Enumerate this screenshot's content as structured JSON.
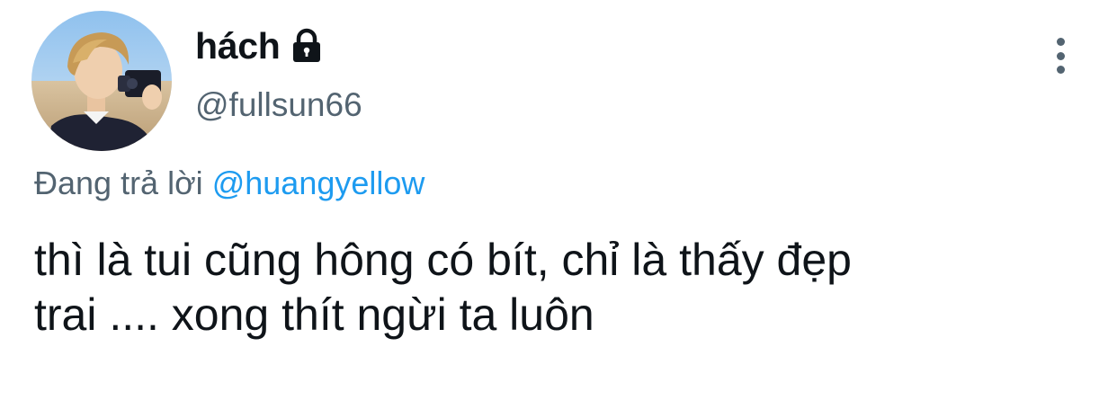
{
  "tweet": {
    "author": {
      "display_name": "hách",
      "handle": "@fullsun66",
      "protected": true,
      "lock_icon": "lock-icon"
    },
    "more_icon": "more-vertical-icon",
    "reply_context": {
      "prefix": "Đang trả lời",
      "mention": "@huangyellow"
    },
    "text_lines": [
      "thì là tui cũng hông có bít, chỉ là thấy đẹp",
      "trai .... xong thít ngừi ta luôn"
    ]
  },
  "colors": {
    "primary_text": "#0f1419",
    "secondary_text": "#536471",
    "link": "#1d9bf0",
    "background": "#ffffff"
  }
}
